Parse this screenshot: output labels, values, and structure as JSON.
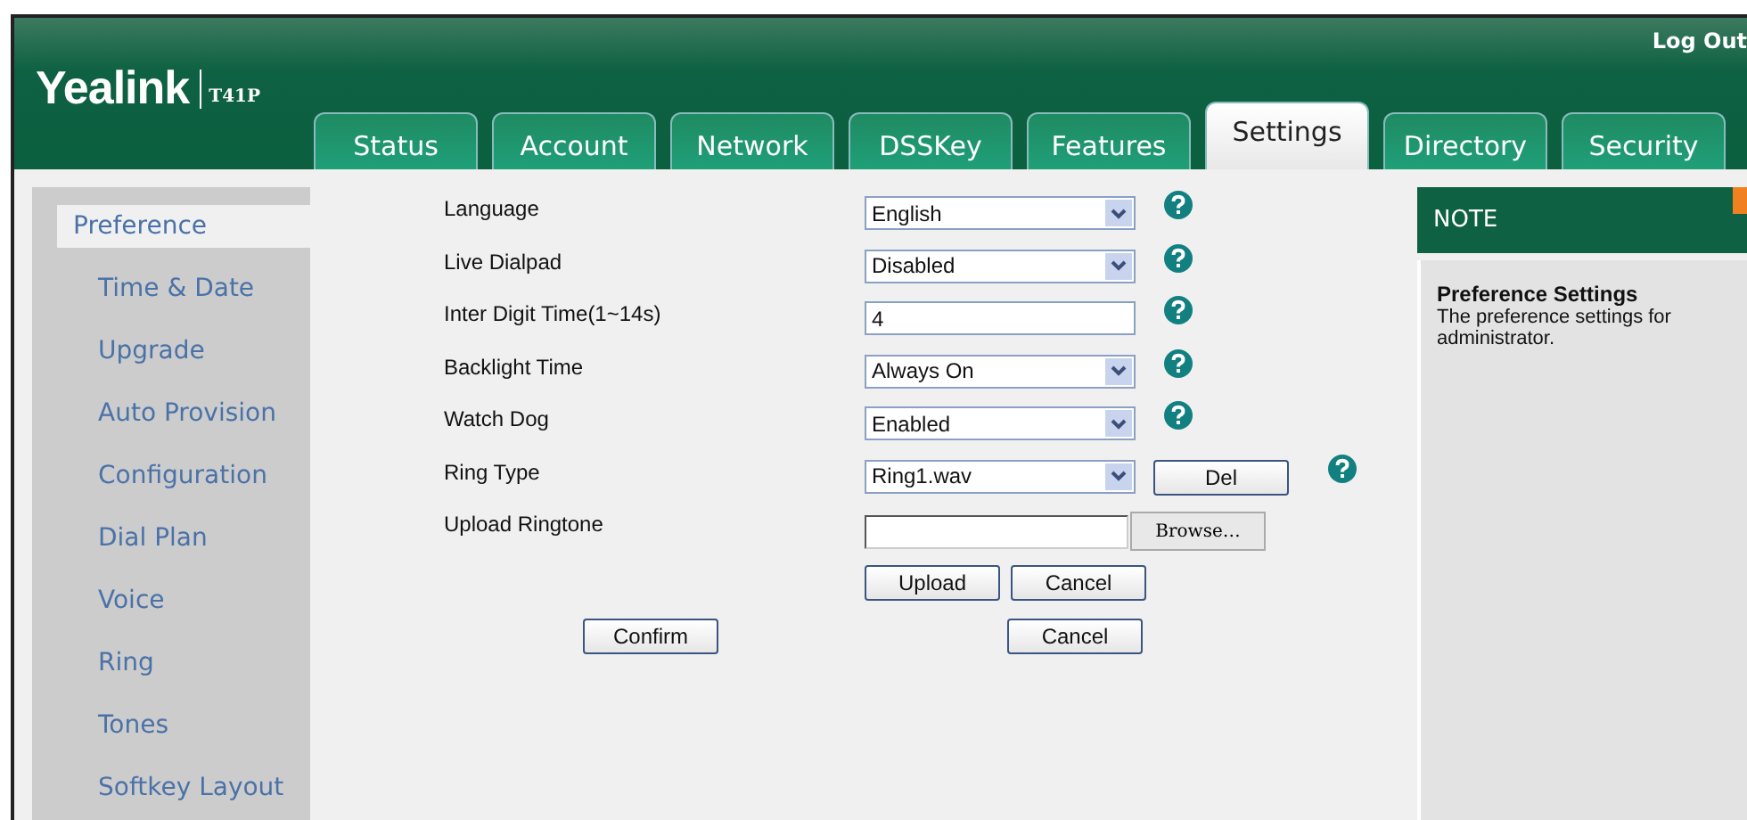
{
  "header": {
    "logo": "Yealink",
    "model": "T41P",
    "logout": "Log Out"
  },
  "tabs": [
    {
      "label": "Status",
      "selected": false
    },
    {
      "label": "Account",
      "selected": false
    },
    {
      "label": "Network",
      "selected": false
    },
    {
      "label": "DSSKey",
      "selected": false
    },
    {
      "label": "Features",
      "selected": false
    },
    {
      "label": "Settings",
      "selected": true
    },
    {
      "label": "Directory",
      "selected": false
    },
    {
      "label": "Security",
      "selected": false
    }
  ],
  "sidebar": {
    "items": [
      {
        "label": "Preference",
        "selected": true
      },
      {
        "label": "Time & Date",
        "selected": false
      },
      {
        "label": "Upgrade",
        "selected": false
      },
      {
        "label": "Auto Provision",
        "selected": false
      },
      {
        "label": "Configuration",
        "selected": false
      },
      {
        "label": "Dial Plan",
        "selected": false
      },
      {
        "label": "Voice",
        "selected": false
      },
      {
        "label": "Ring",
        "selected": false
      },
      {
        "label": "Tones",
        "selected": false
      },
      {
        "label": "Softkey Layout",
        "selected": false
      }
    ]
  },
  "form": {
    "rows": [
      {
        "kind": "select",
        "label": "Language",
        "value": "English"
      },
      {
        "kind": "select",
        "label": "Live Dialpad",
        "value": "Disabled"
      },
      {
        "kind": "text",
        "label": "Inter Digit Time(1~14s)",
        "value": "4"
      },
      {
        "kind": "select",
        "label": "Backlight Time",
        "value": "Always On"
      },
      {
        "kind": "select",
        "label": "Watch Dog",
        "value": "Enabled"
      },
      {
        "kind": "select-button",
        "label": "Ring Type",
        "value": "Ring1.wav",
        "button": "Del"
      },
      {
        "kind": "file",
        "label": "Upload Ringtone",
        "browse": "Browse…",
        "buttons": [
          "Upload",
          "Cancel"
        ]
      }
    ],
    "actions": [
      "Confirm",
      "Cancel"
    ]
  },
  "note": {
    "title": "NOTE",
    "heading": "Preference Settings",
    "text": "The preference settings for administrator."
  }
}
